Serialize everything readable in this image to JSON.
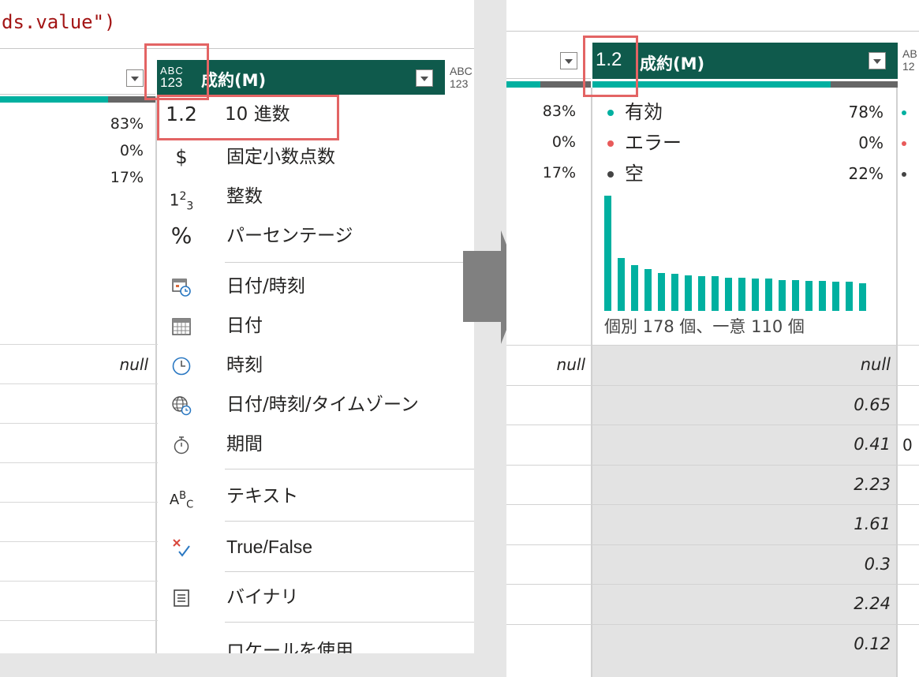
{
  "left": {
    "formula_text": "ds.value\")",
    "column_header": {
      "type_icon_top": "ABC",
      "type_icon_bottom": "123",
      "name": "成約(M)",
      "next_icon_top": "ABC",
      "next_icon_bottom": "123"
    },
    "stats": [
      "83%",
      "0%",
      "17%"
    ],
    "null_value": "null",
    "menu": [
      {
        "icon": "1.2",
        "label": "10 進数"
      },
      {
        "icon": "$",
        "label": "固定小数点数"
      },
      {
        "icon": "123",
        "label": "整数"
      },
      {
        "icon": "%",
        "label": "パーセンテージ"
      },
      {
        "icon": "datetime",
        "label": "日付/時刻"
      },
      {
        "icon": "date",
        "label": "日付"
      },
      {
        "icon": "time",
        "label": "時刻"
      },
      {
        "icon": "globe-clock",
        "label": "日付/時刻/タイムゾーン"
      },
      {
        "icon": "stopwatch",
        "label": "期間"
      },
      {
        "icon": "ABC",
        "label": "テキスト"
      },
      {
        "icon": "true-false",
        "label": "True/False"
      },
      {
        "icon": "binary",
        "label": "バイナリ"
      },
      {
        "icon": "",
        "label": "ロケールを使用..."
      }
    ]
  },
  "right": {
    "column_header": {
      "type_icon": "1.2",
      "name": "成約(M)",
      "next_icon_top": "AB",
      "next_icon_bottom": "12"
    },
    "left_stats": [
      "83%",
      "0%",
      "17%"
    ],
    "legend": [
      {
        "label": "有効",
        "pct": "78%",
        "color": "#00b0a0"
      },
      {
        "label": "エラー",
        "pct": "0%",
        "color": "#e85a5a"
      },
      {
        "label": "空",
        "pct": "22%",
        "color": "#444444"
      }
    ],
    "histogram_values": [
      100,
      46,
      40,
      36,
      33,
      32,
      31,
      30,
      30,
      29,
      29,
      28,
      28,
      27,
      27,
      26,
      26,
      25,
      25,
      24
    ],
    "distinct_text": "個別 178 個、一意 110 個",
    "left_null": "null",
    "values": [
      "null",
      "0.65",
      "0.41",
      "2.23",
      "1.61",
      "0.3",
      "2.24",
      "0.12"
    ],
    "edge_value": "0"
  },
  "colors": {
    "header_bg": "#0f5a4c",
    "valid": "#00b0a0",
    "error": "#e85a5a",
    "empty": "#444444",
    "highlight_box": "#e36464",
    "arrow": "#808080"
  }
}
